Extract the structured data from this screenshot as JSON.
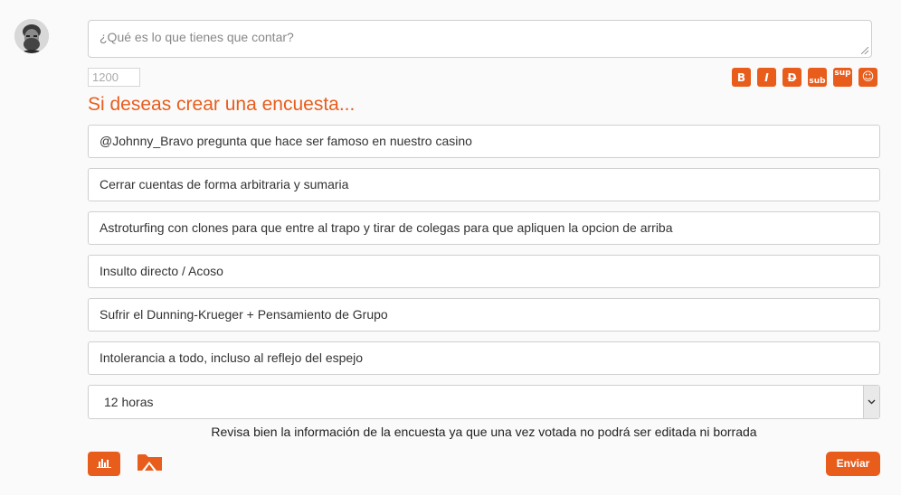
{
  "composer": {
    "placeholder": "¿Qué es lo que tienes que contar?",
    "char_count": "1200"
  },
  "format_toolbar": {
    "bold": "B",
    "italic": "I",
    "strike": "D",
    "sub": "sub",
    "sup": "sup",
    "emoji": "☺"
  },
  "poll": {
    "heading": "Si deseas crear una encuesta...",
    "options": [
      "@Johnny_Bravo pregunta que hace ser famoso en nuestro casino",
      "Cerrar cuentas de forma arbitraria y sumaria",
      "Astroturfing con clones para que entre al trapo y tirar de colegas para que apliquen la opcion de arriba",
      "Insulto directo / Acoso",
      "Sufrir el Dunning-Krueger + Pensamiento de Grupo",
      "Intolerancia a todo, incluso al reflejo del espejo"
    ],
    "duration": "12 horas",
    "warning": "Revisa bien la información de la encuesta ya que una vez votada no podrá ser editada ni borrada"
  },
  "actions": {
    "send_label": "Enviar"
  },
  "colors": {
    "accent": "#e85d1c"
  }
}
